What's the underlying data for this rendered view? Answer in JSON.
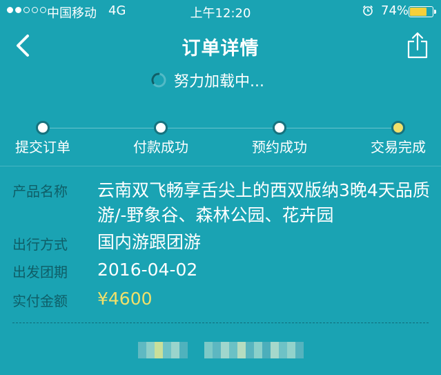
{
  "status_bar": {
    "signal_dots": [
      true,
      true,
      false,
      false,
      false
    ],
    "carrier": "中国移动",
    "network": "4G",
    "time": "上午12:20",
    "battery_percent": "74%",
    "battery_level": 0.74
  },
  "nav": {
    "title": "订单详情"
  },
  "loading": {
    "text": "努力加载中..."
  },
  "progress": {
    "steps": [
      {
        "label": "提交订单",
        "state": "done"
      },
      {
        "label": "付款成功",
        "state": "done"
      },
      {
        "label": "预约成功",
        "state": "done"
      },
      {
        "label": "交易完成",
        "state": "current"
      }
    ]
  },
  "details": {
    "product_label": "产品名称",
    "product_value": "云南双飞畅享舌尖上的西双版纳3晚4天品质游/-野象谷、森林公园、花卉园",
    "travel_label": "出行方式",
    "travel_value": "国内游跟团游",
    "date_label": "出发团期",
    "date_value": "2016-04-02",
    "amount_label": "实付金额",
    "amount_value": "¥4600"
  },
  "colors": {
    "background": "#1aa3b3",
    "label": "#0f5e67",
    "accent": "#f2e06a"
  }
}
